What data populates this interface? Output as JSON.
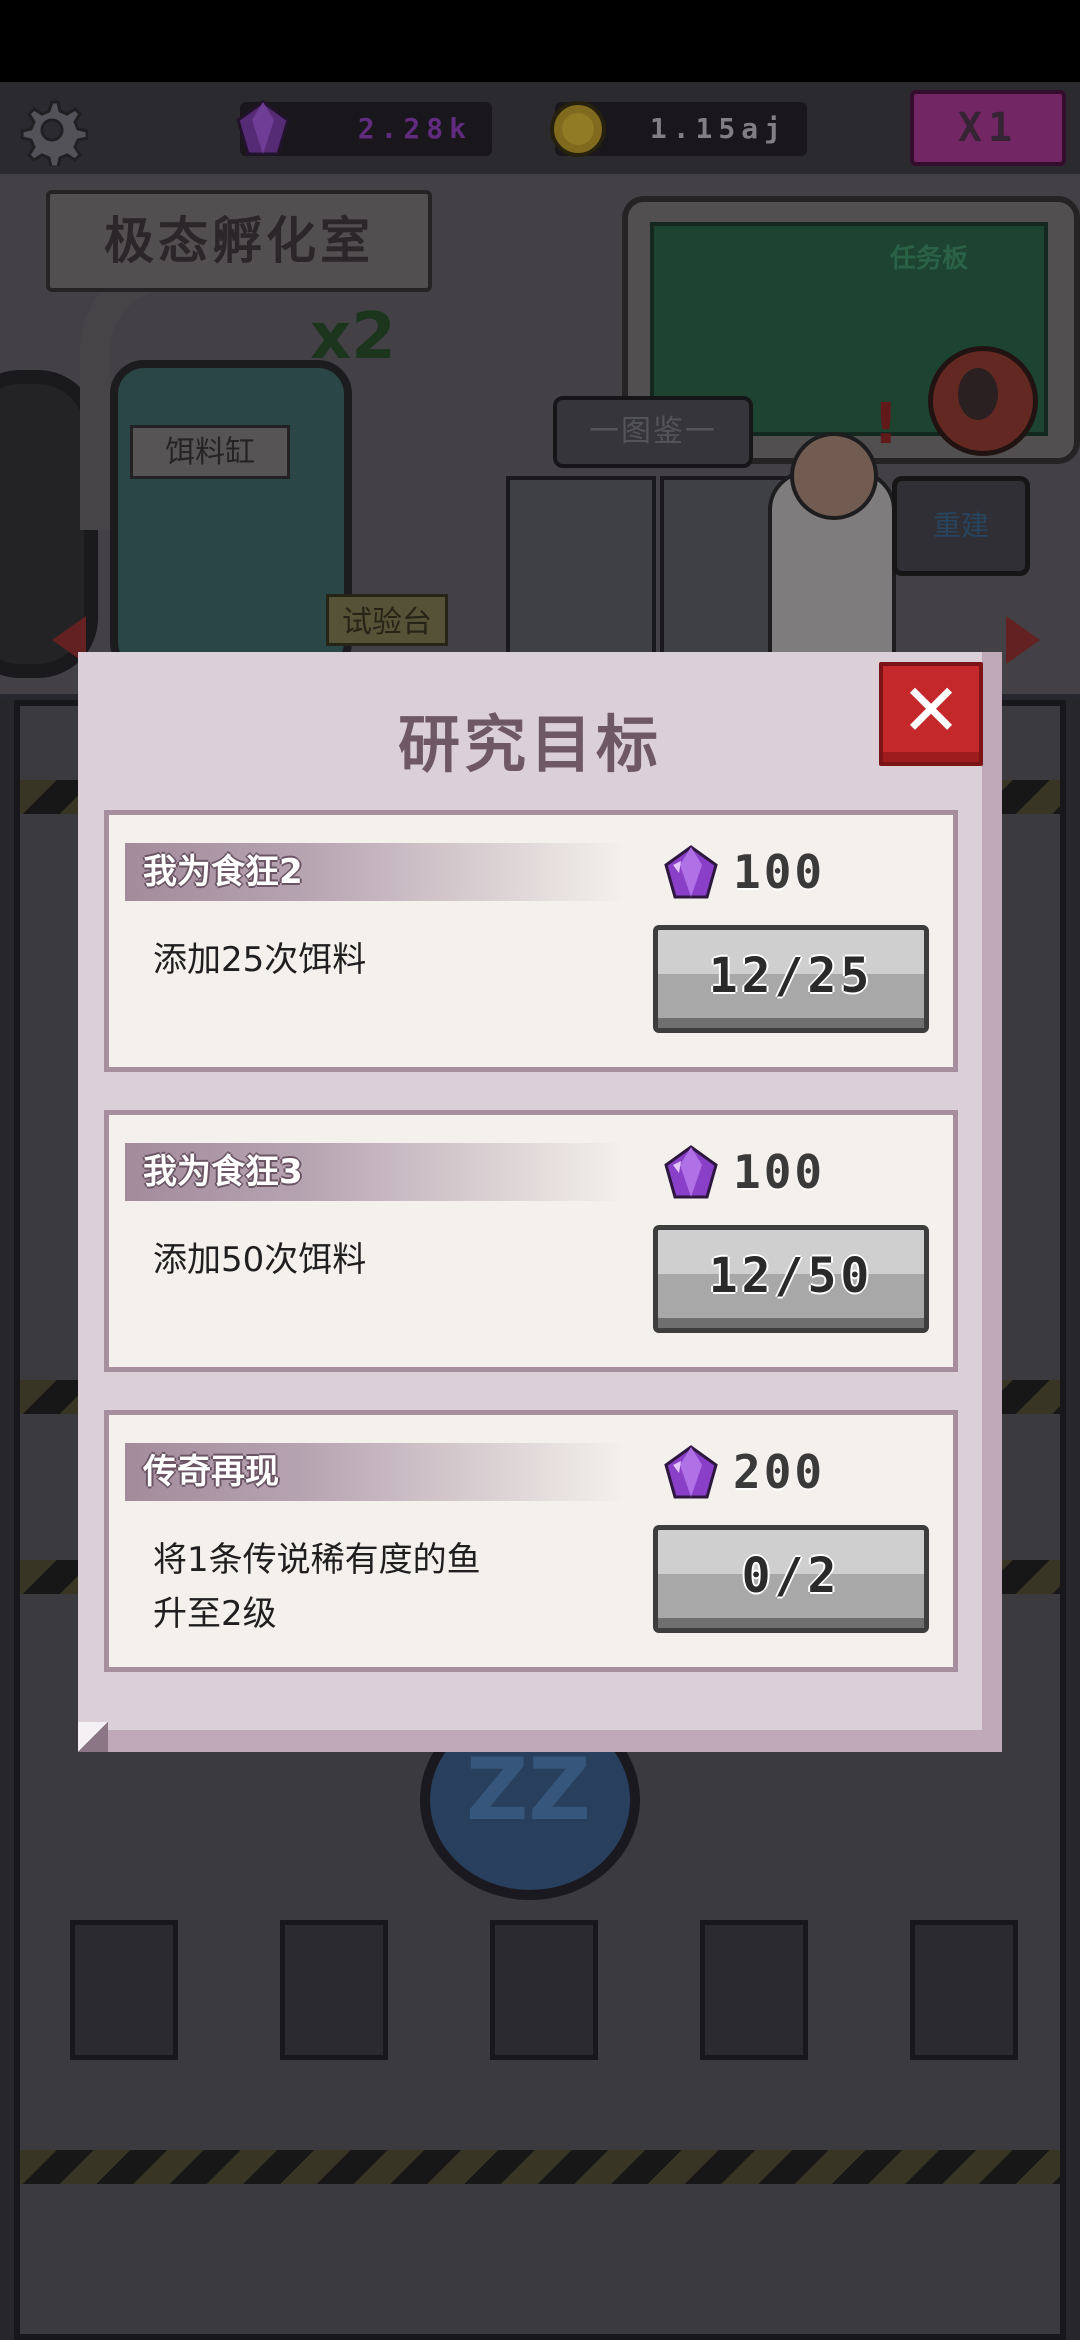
{
  "hud": {
    "gems": "2.28k",
    "coins": "1.15aj",
    "speed": "X1"
  },
  "lab": {
    "room_sign": "极态孵化室",
    "multiplier": "x2",
    "feed_tank_label": "饵料缸",
    "catalog_label": "一图鉴一",
    "test_bench_label": "试验台",
    "task_board_label": "任务板",
    "build_label": "重建",
    "sleep_label": "ZZ"
  },
  "modal": {
    "title": "研究目标",
    "close_glyph": "✕",
    "tasks": [
      {
        "name": "我为食狂2",
        "description": "添加25次饵料",
        "reward": "100",
        "progress": "12/25"
      },
      {
        "name": "我为食狂3",
        "description": "添加50次饵料",
        "reward": "100",
        "progress": "12/50"
      },
      {
        "name": "传奇再现",
        "description": "将1条传说稀有度的鱼升至2级",
        "reward": "200",
        "progress": "0/2"
      }
    ]
  },
  "colors": {
    "gem": "#8a3fc9",
    "close_button": "#c5282a",
    "panel_border": "#a68e9f",
    "panel_bg": "#dcd0d8",
    "title": "#6e5866"
  },
  "icons": {
    "settings": "gear-icon",
    "gem": "gem-icon",
    "coin": "coin-icon",
    "close": "close-icon"
  }
}
